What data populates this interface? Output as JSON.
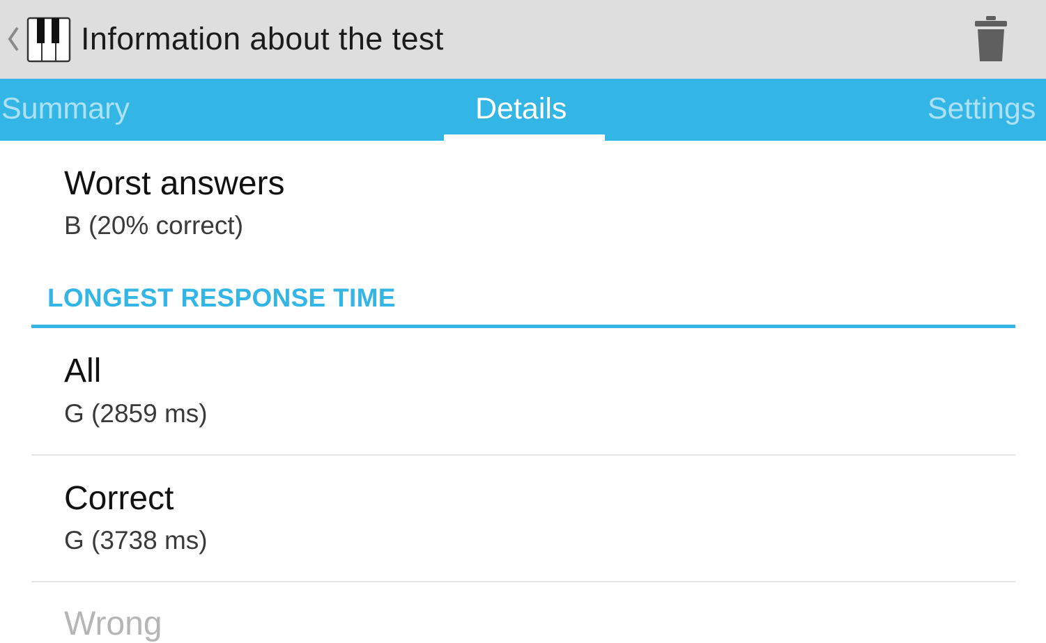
{
  "action_bar": {
    "title": "Information about the test",
    "app_icon": "piano-keys-icon",
    "up_icon": "chevron-left-icon",
    "delete_icon": "trash-icon"
  },
  "tabs": [
    {
      "label": "Summary",
      "selected": false
    },
    {
      "label": "Details",
      "selected": true
    },
    {
      "label": "Settings",
      "selected": false
    }
  ],
  "worst_answers": {
    "title": "Worst answers",
    "value": "B (20% correct)"
  },
  "longest_response_time": {
    "header": "LONGEST RESPONSE TIME",
    "items": [
      {
        "title": "All",
        "value": "G (2859 ms)"
      },
      {
        "title": "Correct",
        "value": "G (3738 ms)"
      },
      {
        "title": "Wrong",
        "value": ""
      }
    ]
  },
  "colors": {
    "accent": "#33b5e5",
    "action_bar_bg": "#dedede",
    "text_primary": "#111111",
    "text_secondary": "#3a3a3a"
  }
}
